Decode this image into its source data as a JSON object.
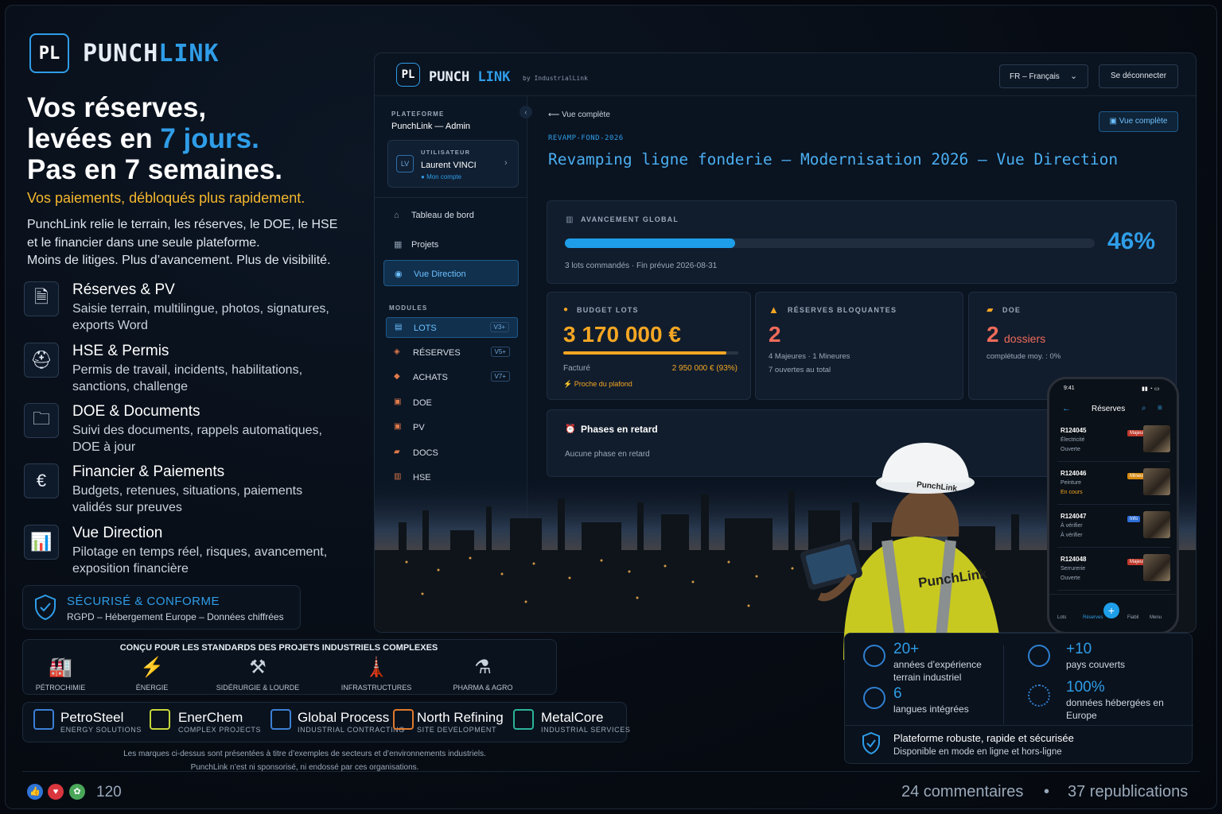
{
  "brand": {
    "logo": "PL",
    "name_a": "PUNCH",
    "name_b": "LINK"
  },
  "hero": {
    "line1": "Vos réserves,",
    "line2a": "levées en ",
    "line2b": "7 jours.",
    "line3": "Pas en 7 semaines.",
    "tagline": "Vos paiements, débloqués plus rapidement.",
    "p1": "PunchLink relie le terrain, les réserves, le DOE, le HSE",
    "p2": "et le financier dans une seule plateforme.",
    "p3": "Moins de litiges. Plus d’avancement. Plus de visibilité."
  },
  "features": [
    {
      "icon": "report-icon",
      "glyph": "🗎",
      "title": "Réserves & PV",
      "desc": "Saisie terrain, multilingue, photos, signatures, exports Word"
    },
    {
      "icon": "helmet-icon",
      "glyph": "⛑",
      "title": "HSE & Permis",
      "desc": "Permis de travail, incidents, habilitations, sanctions, challenge"
    },
    {
      "icon": "folder-icon",
      "glyph": "🗀",
      "title": "DOE & Documents",
      "desc": "Suivi des documents, rappels automatiques, DOE à jour"
    },
    {
      "icon": "euro-icon",
      "glyph": "€",
      "title": "Financier & Paiements",
      "desc": "Budgets, retenues, situations, paiements validés sur preuves"
    },
    {
      "icon": "chart-icon",
      "glyph": "📊",
      "title": "Vue Direction",
      "desc": "Pilotage en temps réel, risques, avancement, exposition financière"
    }
  ],
  "secure": {
    "title": "SÉCURISÉ & CONFORME",
    "desc": "RGPD – Hébergement Europe – Données chiffrées"
  },
  "app": {
    "logo": "PL",
    "name_a": "PUNCH",
    "name_b": "LINK",
    "by": "by IndustrialLink",
    "lang": "FR – Français",
    "logout": "Se déconnecter",
    "platform_label": "PLATEFORME",
    "platform_name": "PunchLink — Admin",
    "user_label": "UTILISATEUR",
    "user_initials": "LV",
    "user_name": "Laurent VINCI",
    "user_account": "Mon compte",
    "nav": [
      "Tableau de bord",
      "Projets",
      "Vue Direction"
    ],
    "modules_label": "MODULES",
    "modules": [
      {
        "label": "LOTS",
        "ver": "V3+"
      },
      {
        "label": "RÉSERVES",
        "ver": "V5+"
      },
      {
        "label": "ACHATS",
        "ver": "V7+"
      },
      {
        "label": "DOE",
        "ver": ""
      },
      {
        "label": "PV",
        "ver": ""
      },
      {
        "label": "DOCS",
        "ver": ""
      },
      {
        "label": "HSE",
        "ver": ""
      }
    ],
    "back": "Vue complète",
    "full_view_btn": "Vue complète",
    "code": "REVAMP-FOND-2026",
    "title": "Revamping ligne fonderie — Modernisation 2026 — Vue Direction",
    "progress": {
      "label": "AVANCEMENT GLOBAL",
      "value_pct": 46,
      "value_text": "46%",
      "sub": "3 lots commandés · Fin prévue 2026-08-31"
    },
    "budget": {
      "label": "BUDGET LOTS",
      "value": "3 170 000 €",
      "invoiced_label": "Facturé",
      "invoiced_value": "2 950 000 € (93%)",
      "invoiced_pct": 93,
      "warning": "Proche du plafond"
    },
    "reserves": {
      "label": "RÉSERVES BLOQUANTES",
      "value": "2",
      "l1": "4 Majeures · 1 Mineures",
      "l2": "7 ouvertes au total"
    },
    "doe": {
      "label": "DOE",
      "value": "2",
      "unit": "dossiers",
      "l1": "complétude moy. : 0%"
    },
    "late": {
      "title": "Phases en retard",
      "desc": "Aucune phase en retard"
    }
  },
  "phone": {
    "time": "9:41",
    "title": "Réserves",
    "rows": [
      {
        "id": "R124045",
        "s1": "Électricité",
        "s2": "Ouverte",
        "tag": "Majeure",
        "color": "#c0392b"
      },
      {
        "id": "R124046",
        "s1": "Peinture",
        "s2": "En cours",
        "tag": "Mineure",
        "color": "#d68910"
      },
      {
        "id": "R124047",
        "s1": "À vérifier",
        "s2": "À vérifier",
        "tag": "Info",
        "color": "#2e6fd8"
      },
      {
        "id": "R124048",
        "s1": "Serrurerie",
        "s2": "Ouverte",
        "tag": "Majeure",
        "color": "#c0392b"
      }
    ],
    "tabs": [
      "Lots",
      "Réserves",
      "Fiabil",
      "Menu"
    ]
  },
  "worker": {
    "helmet": "PunchLink",
    "vest": "PunchLink"
  },
  "standards": {
    "title": "CONÇU POUR LES STANDARDS DES PROJETS INDUSTRIELS COMPLEXES",
    "sectors": [
      {
        "icon": "refinery-icon",
        "glyph": "🏭",
        "label": "PÉTROCHIMIE"
      },
      {
        "icon": "solar-icon",
        "glyph": "⚡",
        "label": "ÉNERGIE"
      },
      {
        "icon": "bolt-icon",
        "glyph": "⚒",
        "label": "SIDÉRURGIE & LOURDE"
      },
      {
        "icon": "tower-icon",
        "glyph": "🗼",
        "label": "INFRASTRUCTURES"
      },
      {
        "icon": "flask-icon",
        "glyph": "⚗",
        "label": "PHARMA & AGRO"
      }
    ]
  },
  "partners": [
    {
      "name": "PetroSteel",
      "sub": "ENERGY SOLUTIONS",
      "color": "#3b7fd6"
    },
    {
      "name": "EnerChem",
      "sub": "COMPLEX PROJECTS",
      "color": "#c6d63b"
    },
    {
      "name": "Global Process",
      "sub": "INDUSTRIAL CONTRACTING",
      "color": "#3b7fd6"
    },
    {
      "name": "North Refining",
      "sub": "SITE DEVELOPMENT",
      "color": "#e07a2e"
    },
    {
      "name": "MetalCore",
      "sub": "INDUSTRIAL SERVICES",
      "color": "#2bb39a"
    }
  ],
  "disclaimer": {
    "l1": "Les marques ci-dessus sont présentées à titre d’exemples de secteurs et d’environnements industriels.",
    "l2": "PunchLink n’est ni sponsorisé, ni endossé par ces organisations."
  },
  "kpis": [
    {
      "value": "20+",
      "label": "années d’expérience terrain industriel"
    },
    {
      "value": "+10",
      "label": "pays couverts"
    },
    {
      "value": "6",
      "label": "langues intégrées"
    },
    {
      "value": "100%",
      "label": "données hébergées en Europe"
    }
  ],
  "robust": {
    "title": "Plateforme robuste, rapide et sécurisée",
    "desc": "Disponible en mode en ligne et hors-ligne"
  },
  "social": {
    "reactions": "120",
    "comments": "24 commentaires",
    "dot": "•",
    "reposts": "37 republications"
  }
}
